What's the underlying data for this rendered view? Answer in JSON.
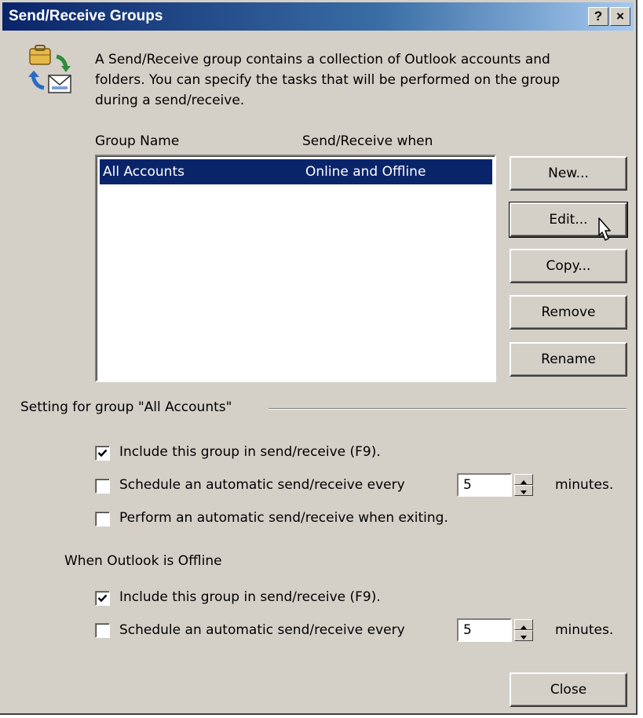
{
  "window": {
    "title": "Send/Receive Groups",
    "help_label": "?",
    "close_label": "×"
  },
  "intro": {
    "line1": "A Send/Receive group contains a collection of Outlook accounts and",
    "line2": "folders. You can specify the tasks that will be performed on the group",
    "line3": "during a send/receive."
  },
  "list": {
    "columns": [
      "Group Name",
      "Send/Receive when"
    ],
    "rows": [
      {
        "name": "All Accounts",
        "when": "Online and Offline"
      }
    ]
  },
  "buttons": {
    "new": "New...",
    "edit": "Edit...",
    "copy": "Copy...",
    "remove": "Remove",
    "rename": "Rename",
    "close": "Close"
  },
  "group_settings": {
    "heading": "Setting for group \"All Accounts\"",
    "online": {
      "include": {
        "label": "Include this group in send/receive (F9).",
        "checked": true
      },
      "schedule": {
        "label": "Schedule an automatic send/receive every",
        "checked": false,
        "value": "5",
        "unit": "minutes."
      },
      "exiting": {
        "label": "Perform an automatic send/receive when exiting.",
        "checked": false
      }
    },
    "offline_heading": "When Outlook is Offline",
    "offline": {
      "include": {
        "label": "Include this group in send/receive (F9).",
        "checked": true
      },
      "schedule": {
        "label": "Schedule an automatic send/receive every",
        "checked": false,
        "value": "5",
        "unit": "minutes."
      }
    }
  },
  "icons": {
    "dialog": "send-receive-icon",
    "cursor": "pointer-cursor-icon"
  },
  "colors": {
    "titlebar_start": "#0a246a",
    "titlebar_end": "#a6caf0",
    "face": "#d4d0c8",
    "selection": "#0a246a"
  }
}
